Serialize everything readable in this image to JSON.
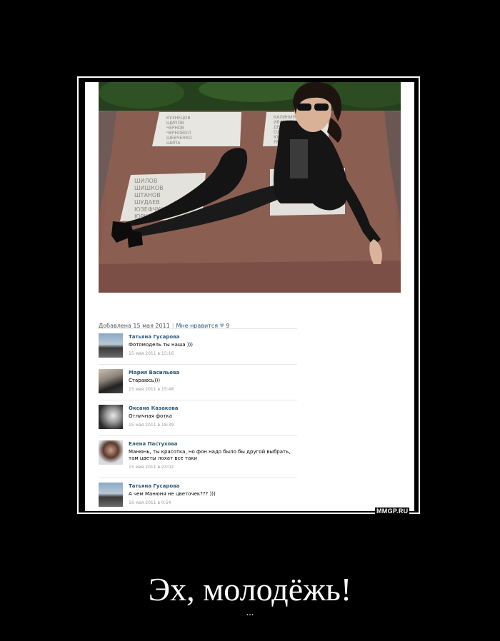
{
  "post": {
    "added_label": "Добавлена 15 мая 2011",
    "likes_label": "Мне нравится",
    "likes_count": "9"
  },
  "comments": [
    {
      "author": "Татьяна Гусарова",
      "text": "Фотомодель ты наша )))",
      "date": "15 мая 2011 в 15:16"
    },
    {
      "author": "Мария Васильева",
      "text": "Стараюсь)))",
      "date": "15 мая 2011 в 15:48"
    },
    {
      "author": "Оксана Казакова",
      "text": "Отличная фотка",
      "date": "15 мая 2011 в 18:39"
    },
    {
      "author": "Елена Пастухова",
      "text": "Манюнь, ты красотка, но фон надо было бы другой выбрать, там цветы лохат все таки",
      "date": "15 мая 2011 в 23:02"
    },
    {
      "author": "Татьяна Гусарова",
      "text": "А чем Манюня не цветочек??? )))",
      "date": "16 мая 2011 в 0:54"
    }
  ],
  "memorial_names_left": [
    "КУЗНЕЦОВ",
    "ЩИПОВ",
    "ЧЕРНОВ",
    "ЧЕРНОВОЛ",
    "ШЕВЧЕНКО",
    "ШИПА"
  ],
  "memorial_names_right": [
    "КАЛИНИН",
    "ИВАНОВ",
    "ДЕМИДОВ",
    "ОЛЕНИКОВ",
    "ЮНЬЕВ",
    "ЯРОНОВ"
  ],
  "memorial_names_bottom": [
    "ШИЛОВ",
    "ШИШКОВ",
    "ШТАНОВ",
    "ШУДАЕВ",
    "ЮЗЕФЧУК",
    "ЮРКЕВИЧ"
  ],
  "watermark": "MMGP.RU",
  "caption": "Эх, молодёжь!",
  "subcaption": "...",
  "colors": {
    "background": "#000000",
    "link": "#2b587a",
    "frame": "#ffffff"
  }
}
